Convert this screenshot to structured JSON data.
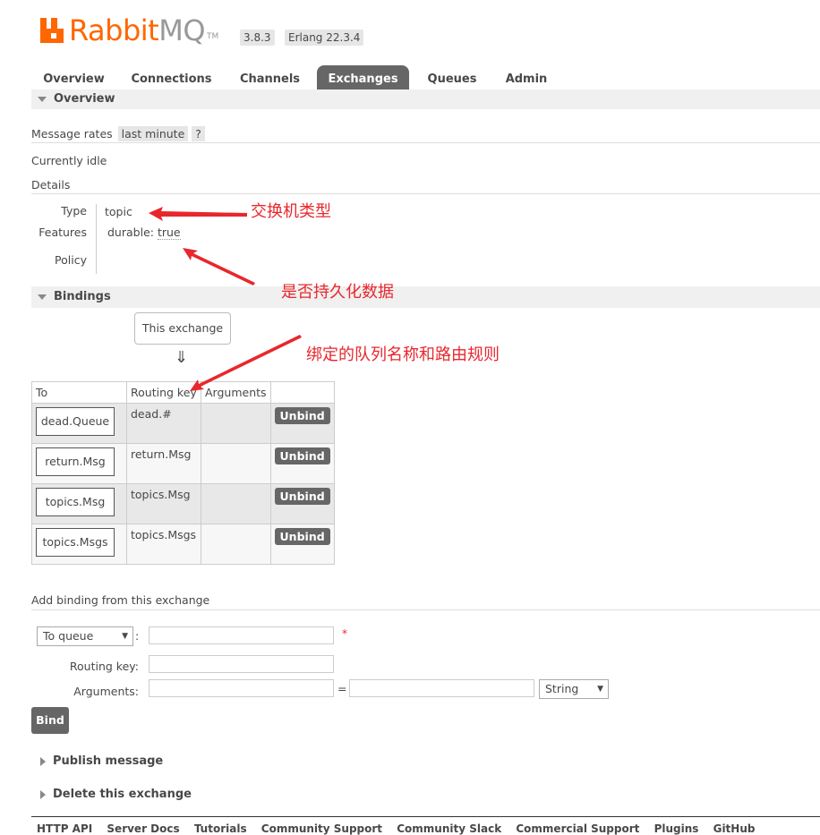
{
  "header": {
    "brand_main": "Rabbit",
    "brand_suffix": "MQ",
    "brand_tm": "TM",
    "version": "3.8.3",
    "erlang": "Erlang 22.3.4"
  },
  "tabs": [
    {
      "label": "Overview"
    },
    {
      "label": "Connections"
    },
    {
      "label": "Channels"
    },
    {
      "label": "Exchanges",
      "active": true
    },
    {
      "label": "Queues"
    },
    {
      "label": "Admin"
    }
  ],
  "overview": {
    "title": "Overview",
    "message_rates_label": "Message rates",
    "message_rates_value": "last minute",
    "help": "?",
    "status": "Currently idle",
    "details_label": "Details",
    "type_label": "Type",
    "type_value": "topic",
    "features_label": "Features",
    "feature_name": "durable:",
    "feature_value": "true",
    "policy_label": "Policy"
  },
  "bindings": {
    "title": "Bindings",
    "this_exchange": "This exchange",
    "arrow": "⇓",
    "columns": [
      "To",
      "Routing key",
      "Arguments",
      ""
    ],
    "rows": [
      {
        "to": "dead.Queue",
        "routing_key": "dead.#",
        "arguments": "",
        "action": "Unbind"
      },
      {
        "to": "return.Msg",
        "routing_key": "return.Msg",
        "arguments": "",
        "action": "Unbind"
      },
      {
        "to": "topics.Msg",
        "routing_key": "topics.Msg",
        "arguments": "",
        "action": "Unbind"
      },
      {
        "to": "topics.Msgs",
        "routing_key": "topics.Msgs",
        "arguments": "",
        "action": "Unbind"
      }
    ]
  },
  "add_binding": {
    "title": "Add binding from this exchange",
    "destination_type": "To queue",
    "colon": ":",
    "required_mark": "*",
    "routing_key_label": "Routing key:",
    "arguments_label": "Arguments:",
    "equals": "=",
    "arg_type": "String",
    "bind_button": "Bind"
  },
  "collapsed_sections": {
    "publish": "Publish message",
    "delete": "Delete this exchange"
  },
  "annotations": {
    "type_note": "交换机类型",
    "durable_note": "是否持久化数据",
    "binding_note": "绑定的队列名称和路由规则"
  },
  "footer": {
    "links": [
      "HTTP API",
      "Server Docs",
      "Tutorials",
      "Community Support",
      "Community Slack",
      "Commercial Support",
      "Plugins",
      "GitHub"
    ]
  },
  "colors": {
    "brand_orange": "#ff6600",
    "annotation_red": "#e8272d",
    "tab_active": "#666666"
  },
  "icons": {
    "dropdown": "triangle-down",
    "collapse_open": "triangle-down",
    "collapse_closed": "triangle-right"
  }
}
